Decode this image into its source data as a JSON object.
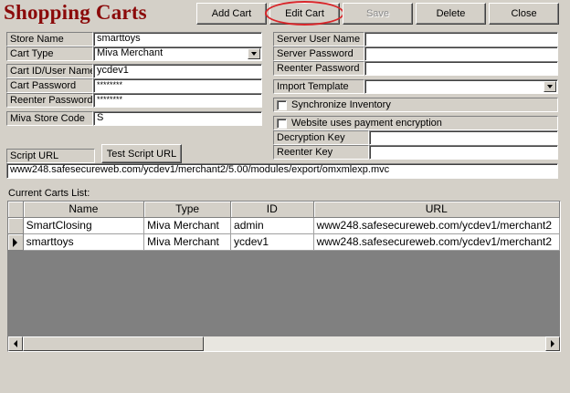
{
  "window": {
    "title": "Shopping Carts"
  },
  "toolbar": {
    "add_label": "Add Cart",
    "edit_label": "Edit Cart",
    "save_label": "Save",
    "delete_label": "Delete",
    "close_label": "Close"
  },
  "left_form": {
    "store_name_label": "Store Name",
    "store_name_value": "smarttoys",
    "cart_type_label": "Cart Type",
    "cart_type_value": "Miva Merchant",
    "cart_id_label": "Cart ID/User Name",
    "cart_id_value": "ycdev1",
    "cart_password_label": "Cart Password",
    "cart_password_value": "********",
    "reenter_password_label": "Reenter Password",
    "reenter_password_value": "********",
    "miva_store_code_label": "Miva Store Code",
    "miva_store_code_value": "S"
  },
  "right_form": {
    "server_user_label": "Server User Name",
    "server_user_value": "",
    "server_password_label": "Server Password",
    "server_password_value": "",
    "server_reenter_label": "Reenter Password",
    "server_reenter_value": "",
    "import_template_label": "Import Template",
    "import_template_value": "",
    "sync_inventory_label": "Synchronize Inventory",
    "sync_inventory_checked": false,
    "payment_encryption_label": "Website uses payment encryption",
    "payment_encryption_checked": false,
    "decryption_key_label": "Decryption Key",
    "decryption_key_value": "",
    "reenter_key_label": "Reenter Key",
    "reenter_key_value": ""
  },
  "script": {
    "label": "Script URL",
    "test_button_label": "Test Script URL",
    "url_value": "www248.safesecureweb.com/ycdev1/merchant2/5.00/modules/export/omxmlexp.mvc"
  },
  "carts_list": {
    "label": "Current Carts List:",
    "columns": [
      "Name",
      "Type",
      "ID",
      "URL"
    ],
    "rows": [
      {
        "name": "SmartClosing",
        "type": "Miva Merchant",
        "id": "admin",
        "url": "www248.safesecureweb.com/ycdev1/merchant2"
      },
      {
        "name": "smarttoys",
        "type": "Miva Merchant",
        "id": "ycdev1",
        "url": "www248.safesecureweb.com/ycdev1/merchant2"
      }
    ],
    "selected_row": 1
  },
  "colors": {
    "title": "#8b0a0a",
    "highlight_ring": "#d8262a",
    "window_bg": "#d4d0c8",
    "grid_bg": "#808080"
  },
  "icons": [
    "combo-arrow-icon",
    "row-pointer-icon",
    "scroll-left-icon",
    "scroll-right-icon"
  ]
}
